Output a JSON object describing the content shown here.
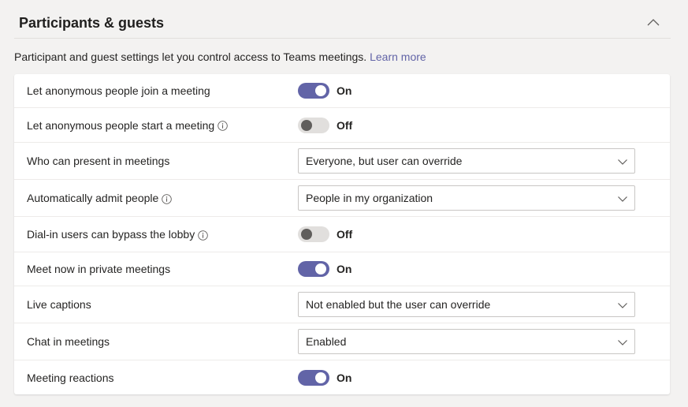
{
  "section": {
    "title": "Participants & guests",
    "description": "Participant and guest settings let you control access to Teams meetings.",
    "learn_more": "Learn more"
  },
  "colors": {
    "accent": "#6264a7",
    "toggle_off": "#e1dfdd",
    "background": "#f3f2f1"
  },
  "settings": [
    {
      "label": "Let anonymous people join a meeting",
      "type": "toggle",
      "state": "On",
      "info": false
    },
    {
      "label": "Let anonymous people start a meeting",
      "type": "toggle",
      "state": "Off",
      "info": true
    },
    {
      "label": "Who can present in meetings",
      "type": "dropdown",
      "value": "Everyone, but user can override",
      "info": false
    },
    {
      "label": "Automatically admit people",
      "type": "dropdown",
      "value": "People in my organization",
      "info": true
    },
    {
      "label": "Dial-in users can bypass the lobby",
      "type": "toggle",
      "state": "Off",
      "info": true
    },
    {
      "label": "Meet now in private meetings",
      "type": "toggle",
      "state": "On",
      "info": false
    },
    {
      "label": "Live captions",
      "type": "dropdown",
      "value": "Not enabled but the user can override",
      "info": false
    },
    {
      "label": "Chat in meetings",
      "type": "dropdown",
      "value": "Enabled",
      "info": false
    },
    {
      "label": "Meeting reactions",
      "type": "toggle",
      "state": "On",
      "info": false
    }
  ]
}
